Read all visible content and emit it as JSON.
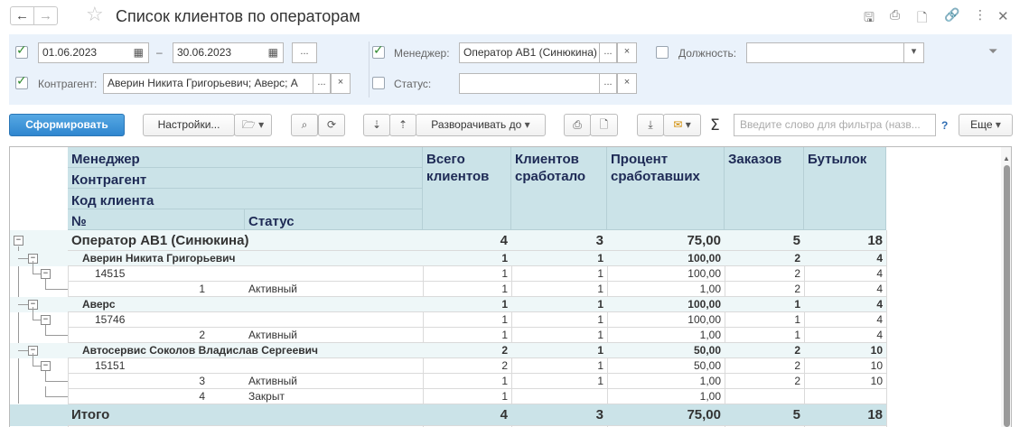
{
  "window": {
    "title": "Список клиентов по операторам",
    "nav_back": "←",
    "nav_forward": "→",
    "icons": [
      "save-icon",
      "print-icon",
      "preview-icon",
      "link-icon",
      "more-icon",
      "close-icon"
    ]
  },
  "filters": {
    "date_from": "01.06.2023",
    "date_dash": "–",
    "date_to": "30.06.2023",
    "period_button": "...",
    "kontragent_label": "Контрагент:",
    "kontragent_value": "Аверин Никита Григорьевич; Аверс; А",
    "manager_label": "Менеджер:",
    "manager_value": "Оператор АВ1 (Синюкина)",
    "position_label": "Должность:",
    "position_value": "",
    "status_label": "Статус:",
    "status_value": "",
    "select_button": "...",
    "clear_button": "×",
    "dropdown_arrow": "▾"
  },
  "toolbar": {
    "generate": "Сформировать",
    "settings": "Настройки...",
    "expand_to": "Разворачивать до",
    "search_placeholder": "Введите слово для фильтра (назв...",
    "help": "?",
    "more": "Еще",
    "sigma": "Σ",
    "caret": "▾"
  },
  "report": {
    "headers": {
      "manager": "Менеджер",
      "kontragent": "Контрагент",
      "client_code": "Код клиента",
      "number": "№",
      "status": "Статус",
      "total_clients": "Всего клиентов",
      "clients_worked": "Клиентов сработало",
      "percent_worked": "Процент сработавших",
      "orders": "Заказов",
      "bottles": "Бутылок"
    },
    "manager_row": {
      "name": "Оператор АВ1 (Синюкина)",
      "total": "4",
      "worked": "3",
      "percent": "75,00",
      "orders": "5",
      "bottles": "18"
    },
    "rows": [
      {
        "kind": "kontragent",
        "name": "Аверин Никита Григорьевич",
        "status": "",
        "total": "1",
        "worked": "1",
        "percent": "100,00",
        "orders": "2",
        "bottles": "4"
      },
      {
        "kind": "code",
        "name": "14515",
        "status": "",
        "total": "1",
        "worked": "1",
        "percent": "100,00",
        "orders": "2",
        "bottles": "4"
      },
      {
        "kind": "detail",
        "name": "1",
        "status": "Активный",
        "total": "1",
        "worked": "1",
        "percent": "1,00",
        "orders": "2",
        "bottles": "4"
      },
      {
        "kind": "kontragent",
        "name": "Аверс",
        "status": "",
        "total": "1",
        "worked": "1",
        "percent": "100,00",
        "orders": "1",
        "bottles": "4"
      },
      {
        "kind": "code",
        "name": "15746",
        "status": "",
        "total": "1",
        "worked": "1",
        "percent": "100,00",
        "orders": "1",
        "bottles": "4"
      },
      {
        "kind": "detail",
        "name": "2",
        "status": "Активный",
        "total": "1",
        "worked": "1",
        "percent": "1,00",
        "orders": "1",
        "bottles": "4"
      },
      {
        "kind": "kontragent",
        "name": "Автосервис Соколов Владислав Сергеевич",
        "status": "",
        "total": "2",
        "worked": "1",
        "percent": "50,00",
        "orders": "2",
        "bottles": "10"
      },
      {
        "kind": "code",
        "name": "15151",
        "status": "",
        "total": "2",
        "worked": "1",
        "percent": "50,00",
        "orders": "2",
        "bottles": "10"
      },
      {
        "kind": "detail",
        "name": "3",
        "status": "Активный",
        "total": "1",
        "worked": "1",
        "percent": "1,00",
        "orders": "2",
        "bottles": "10"
      },
      {
        "kind": "detail",
        "name": "4",
        "status": "Закрыт",
        "total": "1",
        "worked": "",
        "percent": "1,00",
        "orders": "",
        "bottles": ""
      }
    ],
    "total_row": {
      "name": "Итого",
      "total": "4",
      "worked": "3",
      "percent": "75,00",
      "orders": "5",
      "bottles": "18"
    }
  },
  "colors": {
    "header_bg": "#cbe3e8",
    "group_bg": "#eef7f8",
    "header_text": "#1e2a55",
    "primary": "#2f86cf"
  }
}
